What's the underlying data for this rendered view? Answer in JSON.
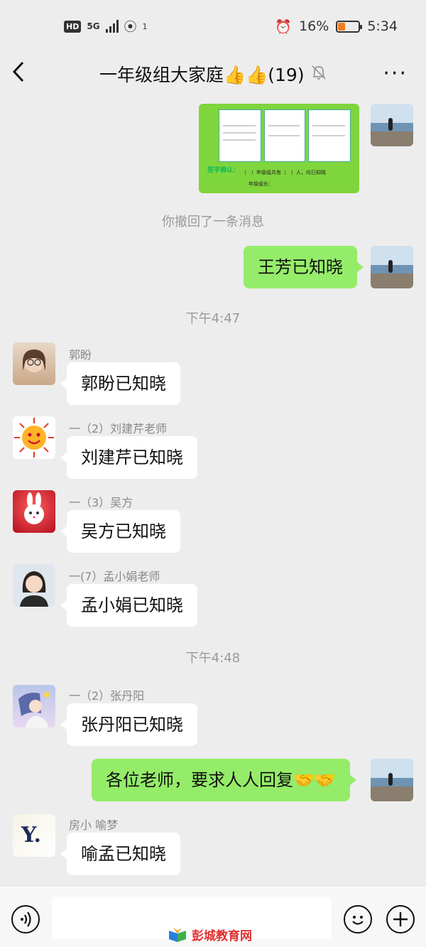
{
  "status_bar": {
    "hd": "HD",
    "network": "5G",
    "hotspot_count": "1",
    "battery": "16%",
    "battery_level": 0.16,
    "time": "5:34"
  },
  "nav": {
    "back_icon": "chevron-left-icon",
    "title": "一年级组大家庭👍👍(19)",
    "mute_icon": "bell-off-icon",
    "more_icon": "more-icon"
  },
  "chat": {
    "image_message": {
      "heading": "签字确认：",
      "line": "（　）年级组共有（　）人，均已知晓",
      "sign": "年级组长："
    },
    "recall_notice": "你撤回了一条消息",
    "my_msg_1": "王芳已知晓",
    "time_1": "下午4:47",
    "messages_a": [
      {
        "sender": "郭盼",
        "text": "郭盼已知晓"
      },
      {
        "sender": "一（2）刘建芹老师",
        "text": "刘建芹已知晓"
      },
      {
        "sender": "一（3）吴方",
        "text": "吴方已知晓"
      },
      {
        "sender": "一(7）孟小娟老师",
        "text": "孟小娟已知晓"
      }
    ],
    "time_2": "下午4:48",
    "msg_zhang": {
      "sender": "一（2）张丹阳",
      "text": "张丹阳已知晓"
    },
    "my_msg_2": "各位老师，要求人人回复🤝🤝",
    "msg_fang": {
      "sender": "房小  喻梦",
      "text": "喻孟已知晓",
      "avatar_letter": "Y."
    }
  },
  "input_bar": {
    "voice_icon": "voice-icon",
    "emoji_icon": "emoji-icon",
    "plus_icon": "plus-icon"
  },
  "watermark": "彭城教育网",
  "colors": {
    "my_bubble": "#95ec69",
    "background": "#ededed",
    "bubble": "#ffffff"
  }
}
